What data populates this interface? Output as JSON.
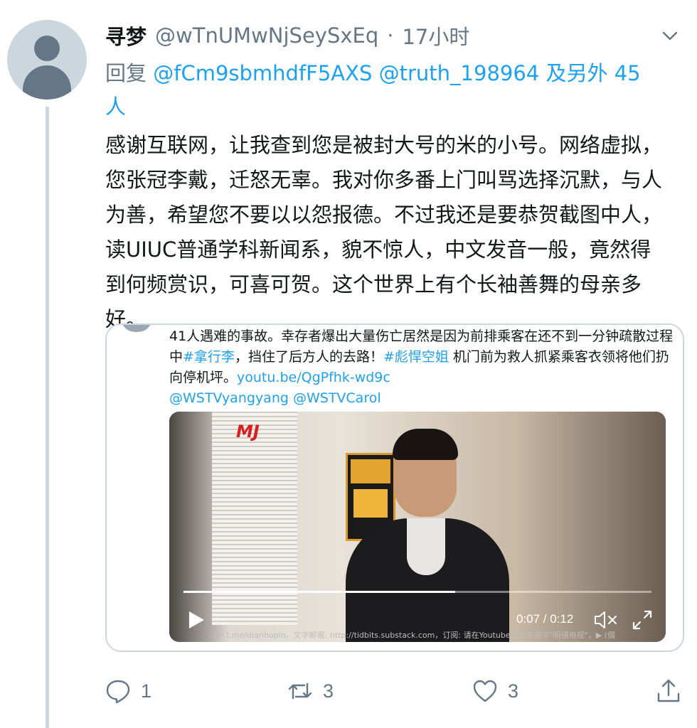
{
  "tweet": {
    "display_name": "寻梦",
    "handle": "@wTnUMwNjSeySxEq",
    "separator": "·",
    "time": "17小时",
    "reply_prefix": "回复",
    "reply_mention_1": "@fCm9sbmhdfF5AXS",
    "reply_mention_2": "@truth_198964",
    "reply_others": "及另外 45 人",
    "body": "感谢互联网，让我查到您是被封大号的米的小号。网络虚拟，您张冠李戴，迁怒无辜。我对你多番上门叫骂选择沉默，与人为善，希望您不要以以怨报德。不过我还是要恭贺截图中人，读UIUC普通学科新闻系，貌不惊人，中文发音一般，竟然得到何频赏识，可喜可贺。这个世界上有个长袖善舞的母亲多好。"
  },
  "quoted": {
    "text_1": "41人遇难的事故。幸存者爆出大量伤亡居然是因为前排乘客在还不到一分钟疏散过程中",
    "hashtag_1": "#拿行李",
    "text_2": "，挡住了后方人的去路！",
    "hashtag_2": "#彪悍空姐",
    "text_3": " 机门前为救人抓紧乘客衣领将他们扔向停机坪。",
    "link": "youtu.be/QgPfhk-wd9c",
    "mention_1": "@WSTVyangyang",
    "mention_2": "@WSTVCarol"
  },
  "video": {
    "logo": "MJ",
    "time_display": "0:07 / 0:12",
    "progress_fraction": 0.58,
    "subtitle": "查: t.me/dianhopin，文字邮报: http://tidbits.substack.com，订阅: 请在Youtube搜索关键字\"明镜电视\"，▶ (個"
  },
  "actions": {
    "reply_count": "1",
    "retweet_count": "3",
    "like_count": "3"
  },
  "colors": {
    "accent": "#1da1f2",
    "muted": "#657786",
    "border": "#ccd6dd"
  },
  "icons": [
    "chevron-down-icon",
    "reply-icon",
    "retweet-icon",
    "like-icon",
    "share-icon",
    "play-icon",
    "mute-icon",
    "fullscreen-icon"
  ]
}
